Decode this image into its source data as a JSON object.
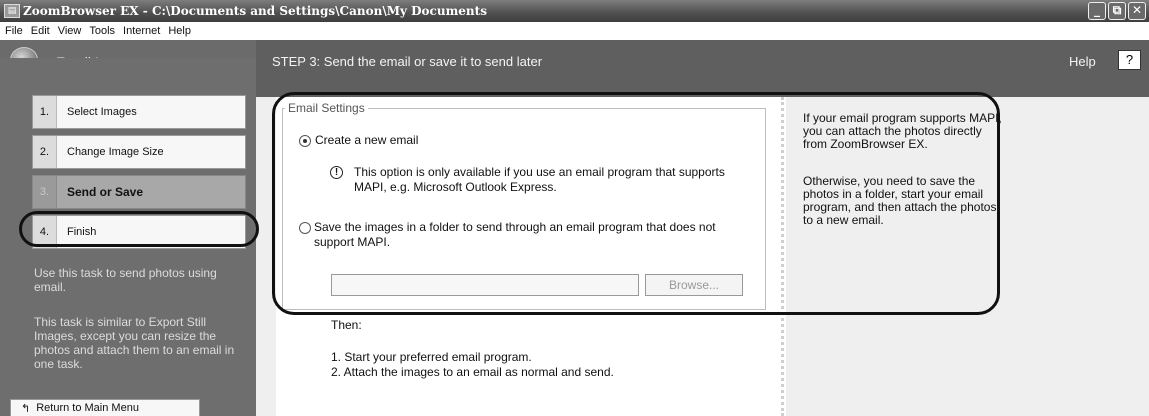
{
  "window": {
    "app_icon": "zoombrowser-app-icon",
    "title": "ZoomBrowser EX  -  C:\\Documents and Settings\\Canon\\My Documents",
    "controls": {
      "minimize": "_",
      "maximize": "⧉",
      "close": "✕"
    }
  },
  "menu": [
    "File",
    "Edit",
    "View",
    "Tools",
    "Internet",
    "Help"
  ],
  "header": {
    "task_title": "Email Images",
    "step_title": "STEP 3: Send the email or save it to send later",
    "help_label": "Help",
    "help_button": "?"
  },
  "steps": [
    {
      "num": "1.",
      "label": "Select Images",
      "active": false
    },
    {
      "num": "2.",
      "label": "Change Image Size",
      "active": false
    },
    {
      "num": "3.",
      "label": "Send or Save",
      "active": true
    },
    {
      "num": "4.",
      "label": "Finish",
      "active": false
    }
  ],
  "left_desc": [
    "Use this task to send photos using email.",
    "This task is similar to Export Still Images, except you can resize the photos and attach them to an email in one task."
  ],
  "return_button": "Return to Main Menu",
  "email_settings": {
    "legend": "Email Settings",
    "option_new": "Create a new email",
    "note": "This option is only available if you use an email program that supports MAPI, e.g.  Microsoft Outlook Express.",
    "option_save": "Save the images in a folder to send through an email program that does not support MAPI.",
    "path_value": "",
    "browse_label": "Browse...",
    "selected_option": "option_new"
  },
  "then_label": "Then:",
  "then_steps": [
    "1.  Start your preferred email program.",
    "2.  Attach the images to an email as normal and send."
  ],
  "side_help": [
    "If your email program supports MAPI, you can attach the photos directly from ZoomBrowser EX.",
    "Otherwise, you need to save the photos in a folder, start your email program, and then attach the photos to a new email."
  ]
}
